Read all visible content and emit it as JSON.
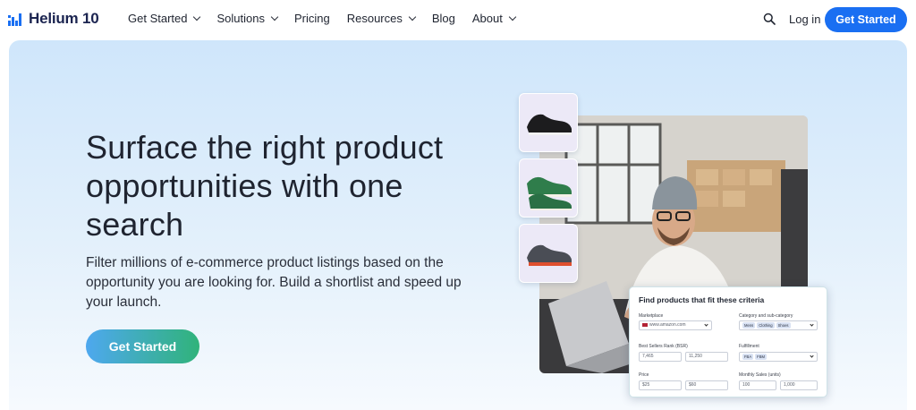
{
  "brand": {
    "name": "Helium 10",
    "accent": "#1a6ff2"
  },
  "nav": {
    "items": [
      {
        "label": "Get Started",
        "has_dropdown": true
      },
      {
        "label": "Solutions",
        "has_dropdown": true
      },
      {
        "label": "Pricing",
        "has_dropdown": false
      },
      {
        "label": "Resources",
        "has_dropdown": true
      },
      {
        "label": "Blog",
        "has_dropdown": false
      },
      {
        "label": "About",
        "has_dropdown": true
      }
    ],
    "search_icon": "search-icon",
    "login_label": "Log in",
    "cta_label": "Get Started"
  },
  "hero": {
    "headline": "Surface the right product opportunities with one search",
    "subtext": "Filter millions of e-commerce product listings based on the opportunity you are looking for. Build a shortlist and speed up your launch.",
    "cta_label": "Get Started",
    "cta_gradient": [
      "#4ea8ef",
      "#30b37a"
    ]
  },
  "filter_card": {
    "title": "Find products that fit these criteria",
    "marketplace_label": "Marketplace",
    "marketplace_value": "www.amazon.com",
    "category_label": "Category and sub-category",
    "category_tags": [
      "Mens",
      "Clothing",
      "Shoes"
    ],
    "bsr_label": "Best Sellers Rank (BSR)",
    "bsr_min": "7,465",
    "bsr_max": "11,250",
    "fulfillment_label": "Fulfillment",
    "fulfillment_tags": [
      "FBA",
      "FBM"
    ],
    "price_label": "Price",
    "price_min": "$25",
    "price_max": "$60",
    "monthly_sales_label": "Monthly Sales (units)",
    "sales_min": "100",
    "sales_max": "1,000"
  }
}
